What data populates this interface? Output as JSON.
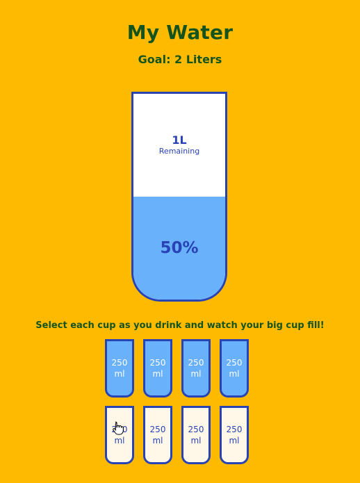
{
  "header": {
    "title": "My Water",
    "goal": "Goal: 2 Liters"
  },
  "big_cup": {
    "remaining_amount": "1L",
    "remaining_label": "Remaining",
    "percentage_label": "50%",
    "fill_fraction": 0.5
  },
  "instructions": "Select each cup as you drink and watch your big cup fill!",
  "cups": [
    {
      "amount": "250",
      "unit": "ml",
      "filled": true
    },
    {
      "amount": "250",
      "unit": "ml",
      "filled": true
    },
    {
      "amount": "250",
      "unit": "ml",
      "filled": true
    },
    {
      "amount": "250",
      "unit": "ml",
      "filled": true
    },
    {
      "amount": "250",
      "unit": "ml",
      "filled": false
    },
    {
      "amount": "250",
      "unit": "ml",
      "filled": false
    },
    {
      "amount": "250",
      "unit": "ml",
      "filled": false
    },
    {
      "amount": "250",
      "unit": "ml",
      "filled": false
    }
  ],
  "colors": {
    "background": "#FDBA00",
    "heading": "#14541C",
    "cup_border": "#2743B5",
    "water": "#69B2FB",
    "empty_cup": "#FFF8E8"
  },
  "cursor": {
    "icon": "hand-pointer-icon"
  }
}
